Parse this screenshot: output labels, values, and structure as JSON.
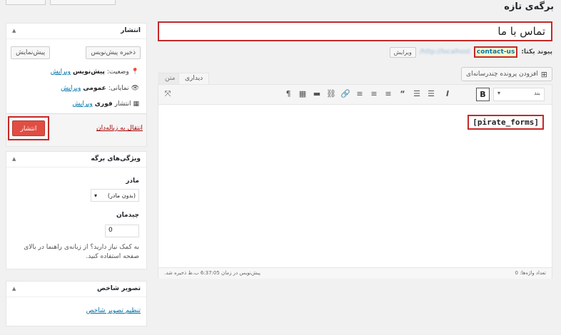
{
  "page": {
    "heading": "برگه‌ی تازه"
  },
  "title": {
    "value": "تماس با ما"
  },
  "permalink": {
    "label": "پیوند یکتا:",
    "slug": "contact-us",
    "edit": "ویرایش"
  },
  "editor": {
    "add_media": "افزودن پرونده چندرسانه‌ای",
    "tab_visual": "دیداری",
    "tab_text": "متن",
    "format_select": "بند",
    "bold": "B",
    "italic": "I",
    "content": "[pirate_forms]",
    "word_count": "تعداد واژه‌ها: 0",
    "draft_saved": "پیش‌نویس در زمان 6:37:05 ب.ظ ذخیره شد."
  },
  "publish_box": {
    "title": "انتشار",
    "save_draft": "ذخیره پیش‌نویس",
    "preview": "پیش‌نمایش",
    "status_label": "وضعیت:",
    "status_value": "پیش‌نویس",
    "visibility_label": "نمایانی:",
    "visibility_value": "عمومی",
    "publish_label": "انتشار",
    "publish_value": "فوری",
    "edit": "ویرایش",
    "trash": "انتقال به زباله‌دان",
    "publish_button": "انتشار"
  },
  "attributes_box": {
    "title": "ویژگی‌های برگه",
    "parent_label": "مادر",
    "parent_value": "(بدون مادر)",
    "order_label": "چیدمان",
    "order_value": "0",
    "help": "به کمک نیاز دارید؟ از زبانه‌ی راهنما در بالای صفحه استفاده کنید."
  },
  "featured_box": {
    "title": "تصویر شاخص",
    "set_link": "تنظیم تصویر شاخص"
  }
}
